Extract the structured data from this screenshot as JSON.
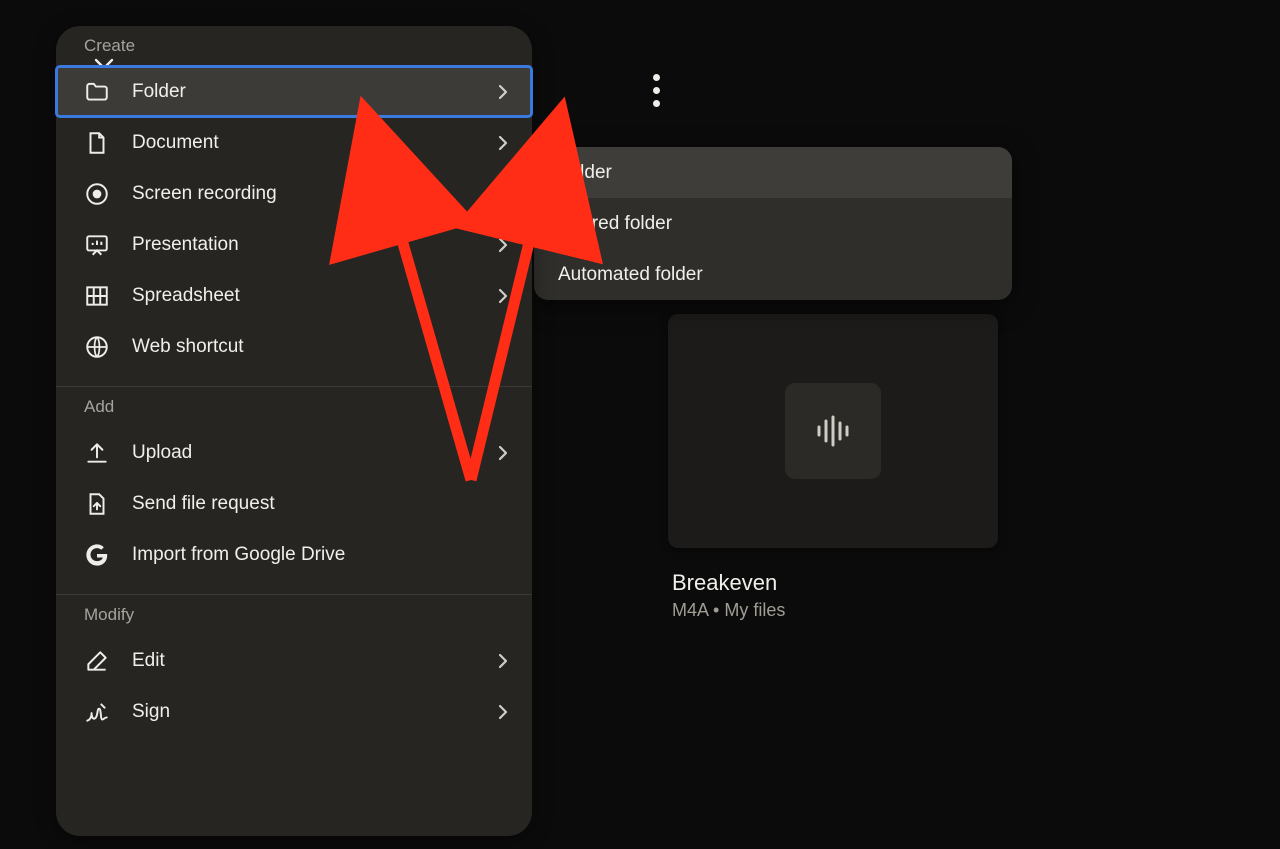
{
  "menu": {
    "sections": [
      {
        "label": "Create",
        "items": [
          {
            "icon": "folder-icon",
            "label": "Folder",
            "chevron": true,
            "selected": true
          },
          {
            "icon": "document-icon",
            "label": "Document",
            "chevron": true
          },
          {
            "icon": "record-icon",
            "label": "Screen recording",
            "chevron": false
          },
          {
            "icon": "presentation-icon",
            "label": "Presentation",
            "chevron": true
          },
          {
            "icon": "spreadsheet-icon",
            "label": "Spreadsheet",
            "chevron": true
          },
          {
            "icon": "globe-icon",
            "label": "Web shortcut",
            "chevron": false
          }
        ]
      },
      {
        "label": "Add",
        "items": [
          {
            "icon": "upload-icon",
            "label": "Upload",
            "chevron": true
          },
          {
            "icon": "file-request-icon",
            "label": "Send file request",
            "chevron": false
          },
          {
            "icon": "google-icon",
            "label": "Import from Google Drive",
            "chevron": false
          }
        ]
      },
      {
        "label": "Modify",
        "items": [
          {
            "icon": "edit-icon",
            "label": "Edit",
            "chevron": true
          },
          {
            "icon": "sign-icon",
            "label": "Sign",
            "chevron": true
          }
        ]
      }
    ]
  },
  "submenu": {
    "items": [
      "Folder",
      "Shared folder",
      "Automated folder"
    ],
    "activeIndex": 0
  },
  "file": {
    "title": "Breakeven",
    "meta": "M4A • My files"
  }
}
